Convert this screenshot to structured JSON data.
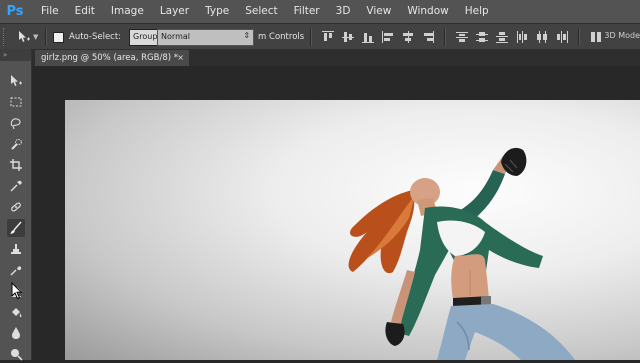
{
  "app": {
    "logo": "Ps"
  },
  "menu": [
    "File",
    "Edit",
    "Image",
    "Layer",
    "Type",
    "Select",
    "Filter",
    "3D",
    "View",
    "Window",
    "Help"
  ],
  "options": {
    "auto_select_label": "Auto-Select:",
    "group_value": "Group",
    "blend_mode": "Normal",
    "transform_controls_label": "m Controls",
    "mode_label": "3D Mode"
  },
  "document": {
    "tab_title": "girlz.png @ 50% (area, RGB/8) *",
    "close_glyph": "×"
  },
  "colors": {
    "ps_blue": "#35a3ff",
    "menubar": "#535353",
    "options": "#424242",
    "workspace": "#282828",
    "jacket": "#2a6b55",
    "denim": "#8ea9c4",
    "hair": "#c2571e"
  }
}
